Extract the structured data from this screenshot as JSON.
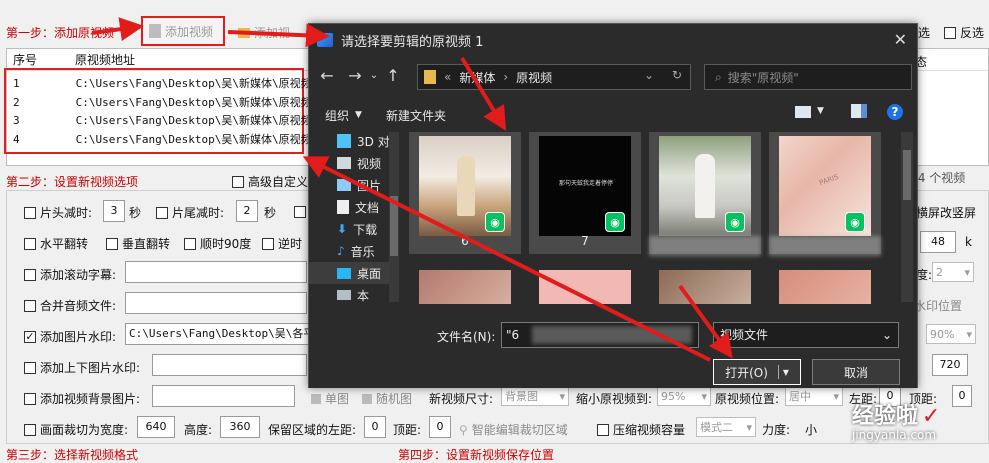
{
  "step1": {
    "title": "第一步：添加原视频",
    "add_video_button": "添加视频",
    "add_text_cut": "添加视",
    "select_all_suffix": "选",
    "invert_select": "反选"
  },
  "video_table": {
    "headers": [
      "序号",
      "原视频地址"
    ],
    "status_header": "态",
    "rows": [
      {
        "index": "1",
        "path": "C:\\Users\\Fang\\Desktop\\吴\\新媒体\\原视频"
      },
      {
        "index": "2",
        "path": "C:\\Users\\Fang\\Desktop\\吴\\新媒体\\原视频"
      },
      {
        "index": "3",
        "path": "C:\\Users\\Fang\\Desktop\\吴\\新媒体\\原视频"
      },
      {
        "index": "4",
        "path": "C:\\Users\\Fang\\Desktop\\吴\\新媒体\\原视频"
      }
    ],
    "total_count": "共 4 个视频"
  },
  "step2": {
    "title": "第二步：设置新视频选项",
    "advanced_custom": "高级自定义",
    "head_cut_label": "片头减时:",
    "head_cut_value": "3",
    "seconds": "秒",
    "tail_cut_label": "片尾减时:",
    "tail_cut_value": "2",
    "seconds2": "秒",
    "hflip": "水平翻转",
    "vflip": "垂直翻转",
    "rot90cw": "顺时90度",
    "rot90ccw": "逆时",
    "scroll_text": "添加滚动字幕:",
    "merge_audio": "合并音频文件:",
    "image_watermark": "添加图片水印:",
    "watermark_path": "C:\\Users\\Fang\\Desktop\\吴\\各平台",
    "top_bottom_watermark": "添加上下图片水印:",
    "background_image": "添加视频背景图片:",
    "single_image": "单图",
    "random_image": "随机图",
    "new_video_size": "新视频尺寸:",
    "new_video_size_value": "背景图",
    "shrink_to": "缩小原视频到:",
    "shrink_value": "95%",
    "position_label": "原视频位置:",
    "position_value": "居中",
    "left_margin": "左距:",
    "left_margin_value": "0",
    "top_margin": "顶距:",
    "top_margin_value": "0",
    "crop_width": "画面裁切为宽度:",
    "crop_width_value": "640",
    "height_label": "高度:",
    "height_value": "360",
    "keep_left": "保留区域的左距:",
    "keep_left_value": "0",
    "keep_top": "顶距:",
    "keep_top_value": "0",
    "smart_crop": "智能编辑裁切区域",
    "compress": "压缩视频容量",
    "mode_value": "模式二",
    "strength": "力度:",
    "strength_value": "小",
    "landscape_to_portrait": "横屏改竖屏",
    "right_value_48": "48",
    "right_unit_k": "k",
    "degree_label": "度:",
    "degree_value": "2",
    "watermark_position": "水印位置",
    "percent_value": "90%",
    "value_720": "720"
  },
  "footer": {
    "step3": "第三步：选择新视频格式",
    "step4": "第四步：设置新视频保存位置"
  },
  "dialog": {
    "title": "请选择要剪辑的原视频 1",
    "breadcrumb": [
      "新媒体",
      "原视频"
    ],
    "breadcrumb_prefix": "«",
    "search_placeholder": "搜索\"原视频\"",
    "organize": "组织",
    "new_folder": "新建文件夹",
    "sidebar": [
      "3D 对",
      "视频",
      "图片",
      "文档",
      "下载",
      "音乐",
      "桌面",
      "本"
    ],
    "thumbs": [
      {
        "label": "6"
      },
      {
        "label": "7"
      },
      {
        "label": ""
      },
      {
        "label": ""
      }
    ],
    "thumb7_caption": "那句天蚊我走着停停",
    "brand_text": "PARIS",
    "filename_label": "文件名(N):",
    "filename_value": "\"6",
    "filter_value": "视频文件",
    "open_button": "打开(O)",
    "cancel_button": "取消"
  },
  "watermark": {
    "brand": "经验啦",
    "check": "✓",
    "url": "jingyanla.com"
  },
  "colors": {
    "accent_red": "#e21b1b",
    "wechat_green": "#07c160",
    "step_red": "#d00000"
  }
}
